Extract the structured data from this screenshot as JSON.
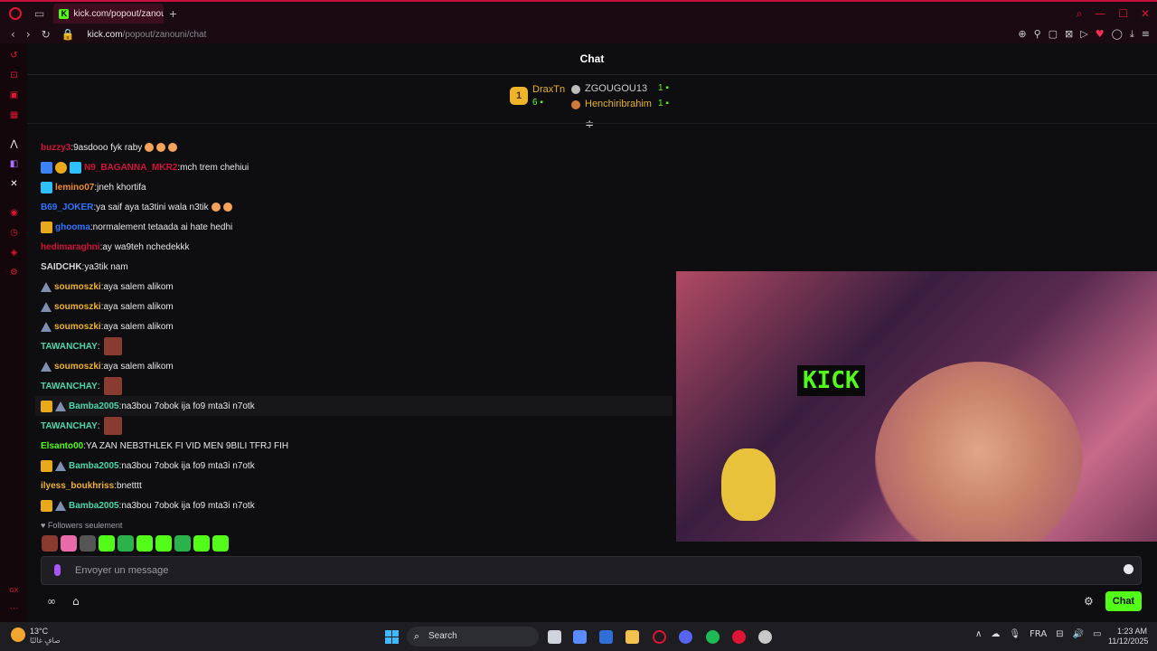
{
  "browser": {
    "tab_title": "kick.com/popout/zanouni",
    "new_tab_icon": "plus-icon",
    "url_host": "kick.com",
    "url_path": "/popout/zanouni/chat"
  },
  "chat": {
    "title": "Chat",
    "leaderboard": [
      {
        "rank": "1",
        "name": "DraxTn",
        "count": "6"
      },
      {
        "name": "ZGOUGOU13",
        "count": "1"
      },
      {
        "name": "Henchiribrahim",
        "count": "1"
      }
    ],
    "messages": [
      {
        "user": "buzzy3",
        "color": "#d1123a",
        "text": "9asdooo fyk raby",
        "emotes": 3
      },
      {
        "user": "N9_BAGANNA_MKR2",
        "color": "#d1123a",
        "text": "mch trem chehiui",
        "badges": [
          "sub",
          "num",
          "gift"
        ]
      },
      {
        "user": "lemino07",
        "color": "#f08a24",
        "text": "jneh khortifa",
        "badges": [
          "gift"
        ]
      },
      {
        "user": "B69_JOKER",
        "color": "#2f74ff",
        "text": "ya saif aya ta3tini wala n3tik",
        "emotes": 2
      },
      {
        "user": "ghooma",
        "color": "#2f74ff",
        "text": "normalement tetaada ai hate hedhi",
        "badges": [
          "crown"
        ]
      },
      {
        "user": "hedimaraghni",
        "color": "#d1123a",
        "text": "ay wa9teh nchedekkk"
      },
      {
        "user": "SAIDCHK",
        "color": "#d8d8d8",
        "text": "ya3tik nam"
      },
      {
        "user": "soumoszki",
        "color": "#f0b429",
        "text": "aya salem alikom",
        "badges": [
          "tri"
        ]
      },
      {
        "user": "soumoszki",
        "color": "#f0b429",
        "text": "aya salem alikom",
        "badges": [
          "tri"
        ]
      },
      {
        "user": "soumoszki",
        "color": "#f0b429",
        "text": "aya salem alikom",
        "badges": [
          "tri"
        ]
      },
      {
        "user": "TAWANCHAY",
        "color": "#4ad8a8",
        "text": "",
        "img_emote": true
      },
      {
        "user": "soumoszki",
        "color": "#f0b429",
        "text": "aya salem alikom",
        "badges": [
          "tri"
        ]
      },
      {
        "user": "TAWANCHAY",
        "color": "#4ad8a8",
        "text": "",
        "img_emote": true
      },
      {
        "user": "Bamba2005",
        "color": "#4ad8a8",
        "text": "na3bou 7obok ija fo9 mta3i n7otk",
        "badges": [
          "crown",
          "tri"
        ],
        "highlight": true
      },
      {
        "user": "TAWANCHAY",
        "color": "#4ad8a8",
        "text": "",
        "img_emote": true
      },
      {
        "user": "Elsanto00",
        "color": "#53fc18",
        "text": "YA ZAN NEB3THLEK FI VID MEN 9BILI TFRJ FIH"
      },
      {
        "user": "Bamba2005",
        "color": "#4ad8a8",
        "text": "na3bou 7obok ija fo9 mta3i n7otk",
        "badges": [
          "crown",
          "tri"
        ]
      },
      {
        "user": "ilyess_boukhriss",
        "color": "#f0b429",
        "text": "bnetttt"
      },
      {
        "user": "Bamba2005",
        "color": "#4ad8a8",
        "text": "na3bou 7obok ija fo9 mta3i n7otk",
        "badges": [
          "crown",
          "tri"
        ]
      }
    ],
    "followers_only": "Followers seulement",
    "emote_bar": [
      "#8a3b30",
      "#e86aa8",
      "#555",
      "#53fc18",
      "#2bb24a",
      "#53fc18",
      "#53fc18",
      "#2bb24a",
      "#53fc18",
      "#53fc18"
    ],
    "input_placeholder": "Envoyer un message",
    "send_label": "Chat"
  },
  "taskbar": {
    "temp": "13°C",
    "weather_desc": "صافٍ غالبًا",
    "search_label": "Search",
    "lang": "FRA",
    "time": "1:23 AM",
    "date": "11/12/2025"
  },
  "colors": {
    "accent": "#53fc18",
    "opera_red": "#e01535"
  }
}
